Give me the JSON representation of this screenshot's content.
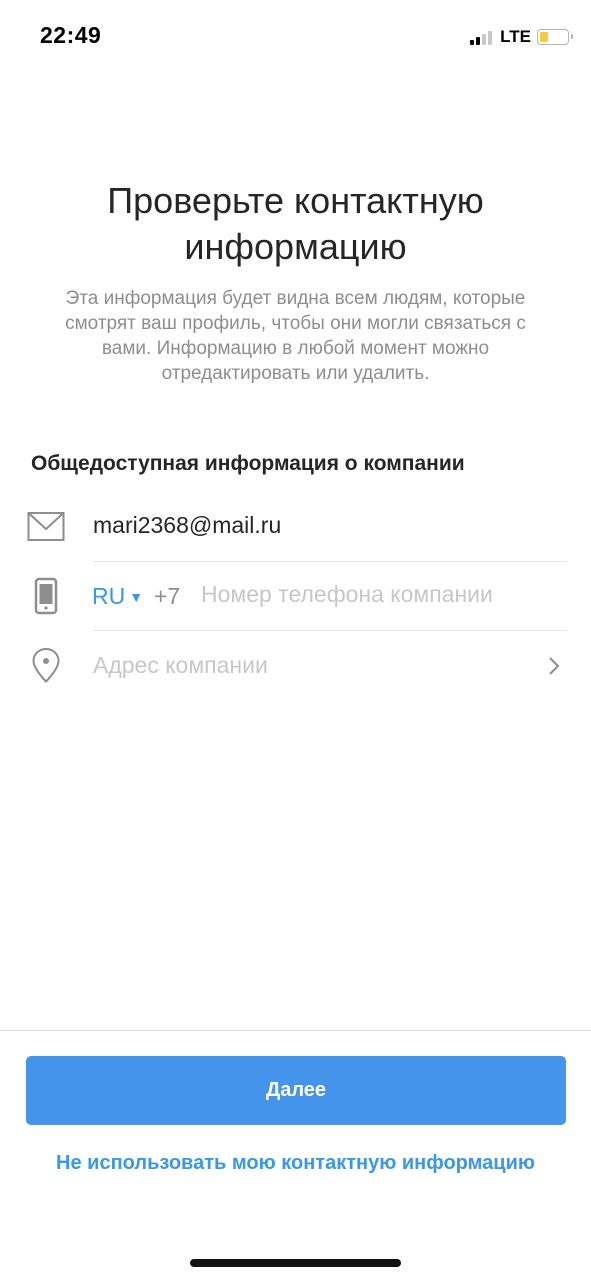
{
  "status_bar": {
    "time": "22:49",
    "network": "LTE",
    "signal_icon": "cellular-signal-icon",
    "battery_icon": "battery-icon",
    "battery_color": "#f5cc3c"
  },
  "header": {
    "title": "Проверьте контактную информацию",
    "subtitle": "Эта информация будет видна всем людям, которые смотрят ваш профиль, чтобы они могли связаться с вами. Информацию в любой момент можно отредактировать или удалить."
  },
  "section": {
    "title": "Общедоступная информация о компании"
  },
  "contact": {
    "email": {
      "icon": "envelope-icon",
      "value": "mari2368@mail.ru"
    },
    "phone": {
      "icon": "phone-icon",
      "country_code": "RU",
      "caret_icon": "caret-down-icon",
      "dial_code": "+7",
      "placeholder": "Номер телефона компании",
      "value": ""
    },
    "address": {
      "icon": "location-pin-icon",
      "placeholder": "Адрес компании",
      "chevron_icon": "chevron-right-icon"
    }
  },
  "actions": {
    "next_label": "Далее",
    "skip_label": "Не использовать мою контактную информацию"
  },
  "colors": {
    "accent": "#3897f0",
    "button": "#4494ec",
    "text_primary": "#262626",
    "text_secondary": "#8e8e8e",
    "placeholder": "#c7c7c7"
  }
}
